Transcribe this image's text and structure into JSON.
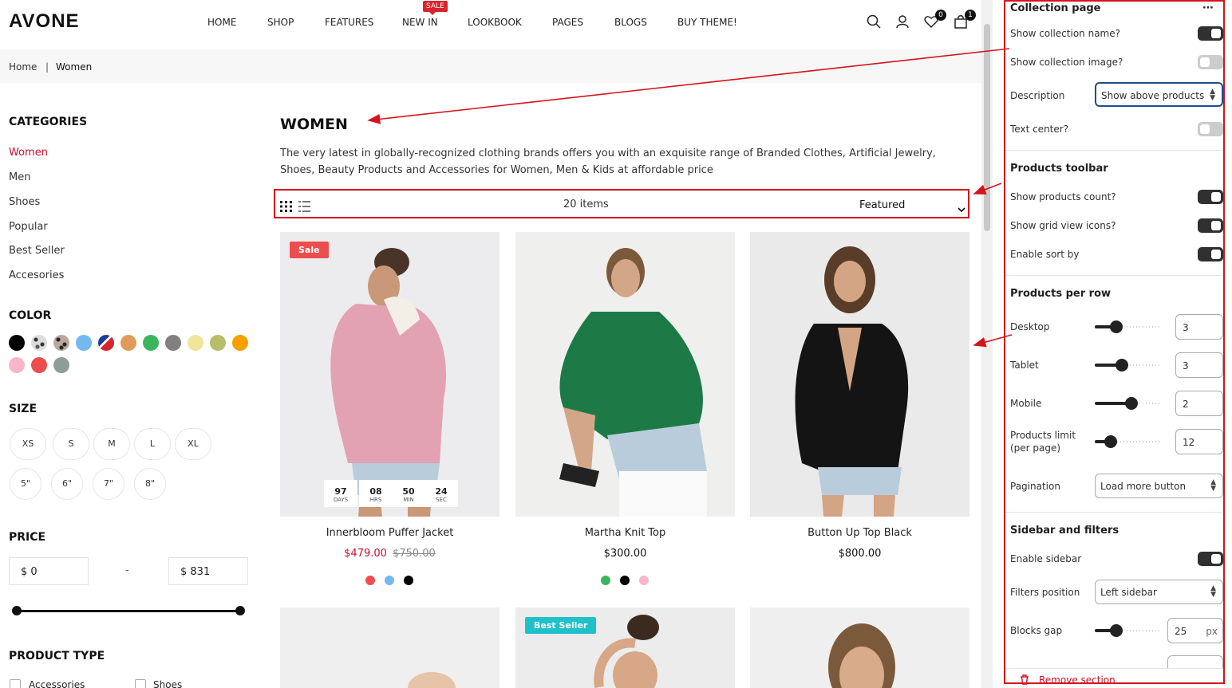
{
  "header": {
    "logo": "AVONE",
    "nav": [
      "HOME",
      "SHOP",
      "FEATURES",
      "NEW IN",
      "LOOKBOOK",
      "PAGES",
      "BLOGS",
      "BUY THEME!"
    ],
    "sale_badge": "SALE",
    "wishlist_count": "0",
    "cart_count": "1",
    "icons": [
      "search-icon",
      "user-icon",
      "heart-icon",
      "bag-icon"
    ]
  },
  "breadcrumb": {
    "home": "Home",
    "sep": "|",
    "current": "Women"
  },
  "sidebar": {
    "categories_title": "CATEGORIES",
    "categories": [
      "Women",
      "Men",
      "Shoes",
      "Popular",
      "Best Seller",
      "Accesories"
    ],
    "color_title": "COLOR",
    "colors": [
      "#000000",
      "pattern-leopard-light",
      "pattern-leopard-dark",
      "#74b8f0",
      "pattern-stripes",
      "#e09a5a",
      "#3bb55c",
      "#808080",
      "#efe69b",
      "#b7bd6a",
      "#f7a000",
      "#f9b6c6",
      "#ec4e4e",
      "#8e9d96"
    ],
    "size_title": "SIZE",
    "sizes": [
      "XS",
      "S",
      "M",
      "L",
      "XL",
      "5\"",
      "6\"",
      "7\"",
      "8\""
    ],
    "price_title": "PRICE",
    "price_min": "$ 0",
    "price_sep": "-",
    "price_max": "$ 831",
    "product_type_title": "PRODUCT TYPE",
    "product_types": [
      "Accessories",
      "Shoes"
    ]
  },
  "collection": {
    "title": "WOMEN",
    "description": "The very latest in globally-recognized clothing brands offers you with an exquisite range of Branded Clothes, Artificial Jewelry, Shoes, Beauty Products and Accessories for Women, Men & Kids at affordable price",
    "items_count": "20 items",
    "sort": "Featured"
  },
  "products": [
    {
      "name": "Innerbloom Puffer Jacket",
      "price": "$479.00",
      "compare_price": "$750.00",
      "badge": "Sale",
      "colors": [
        "#ec4e4e",
        "#74b8f0",
        "#000000"
      ],
      "countdown": [
        {
          "v": "97",
          "u": "DAYS"
        },
        {
          "v": "08",
          "u": "HRS"
        },
        {
          "v": "50",
          "u": "MIN"
        },
        {
          "v": "24",
          "u": "SEC"
        }
      ]
    },
    {
      "name": "Martha Knit Top",
      "price": "$300.00",
      "compare_price": "",
      "badge": "",
      "colors": [
        "#3bb55c",
        "#000000",
        "#f9b6c6"
      ]
    },
    {
      "name": "Button Up Top Black",
      "price": "$800.00",
      "compare_price": "",
      "badge": "",
      "colors": []
    },
    {
      "badge": "Best Seller"
    }
  ],
  "settings_panel": {
    "title": "Collection page",
    "more_icon": "more-icon",
    "show_collection_name": {
      "label": "Show collection name?",
      "on": true
    },
    "show_collection_image": {
      "label": "Show collection image?",
      "on": false
    },
    "description": {
      "label": "Description",
      "value": "Show above products"
    },
    "text_center": {
      "label": "Text center?",
      "on": false
    },
    "toolbar_title": "Products toolbar",
    "show_products_count": {
      "label": "Show products count?",
      "on": true
    },
    "show_grid_icons": {
      "label": "Show grid view icons?",
      "on": true
    },
    "enable_sort": {
      "label": "Enable sort by",
      "on": true
    },
    "per_row_title": "Products per row",
    "desktop": {
      "label": "Desktop",
      "value": "3"
    },
    "tablet": {
      "label": "Tablet",
      "value": "3"
    },
    "mobile": {
      "label": "Mobile",
      "value": "2"
    },
    "products_limit": {
      "label": "Products limit",
      "label2": "(per page)",
      "value": "12"
    },
    "pagination": {
      "label": "Pagination",
      "value": "Load more button"
    },
    "sidebar_title": "Sidebar and filters",
    "enable_sidebar": {
      "label": "Enable sidebar",
      "on": true
    },
    "filters_position": {
      "label": "Filters position",
      "value": "Left sidebar"
    },
    "blocks_gap": {
      "label": "Blocks gap",
      "value": "25",
      "unit": "px"
    },
    "remove_section": "Remove section",
    "accent_color": "#d3141c"
  }
}
